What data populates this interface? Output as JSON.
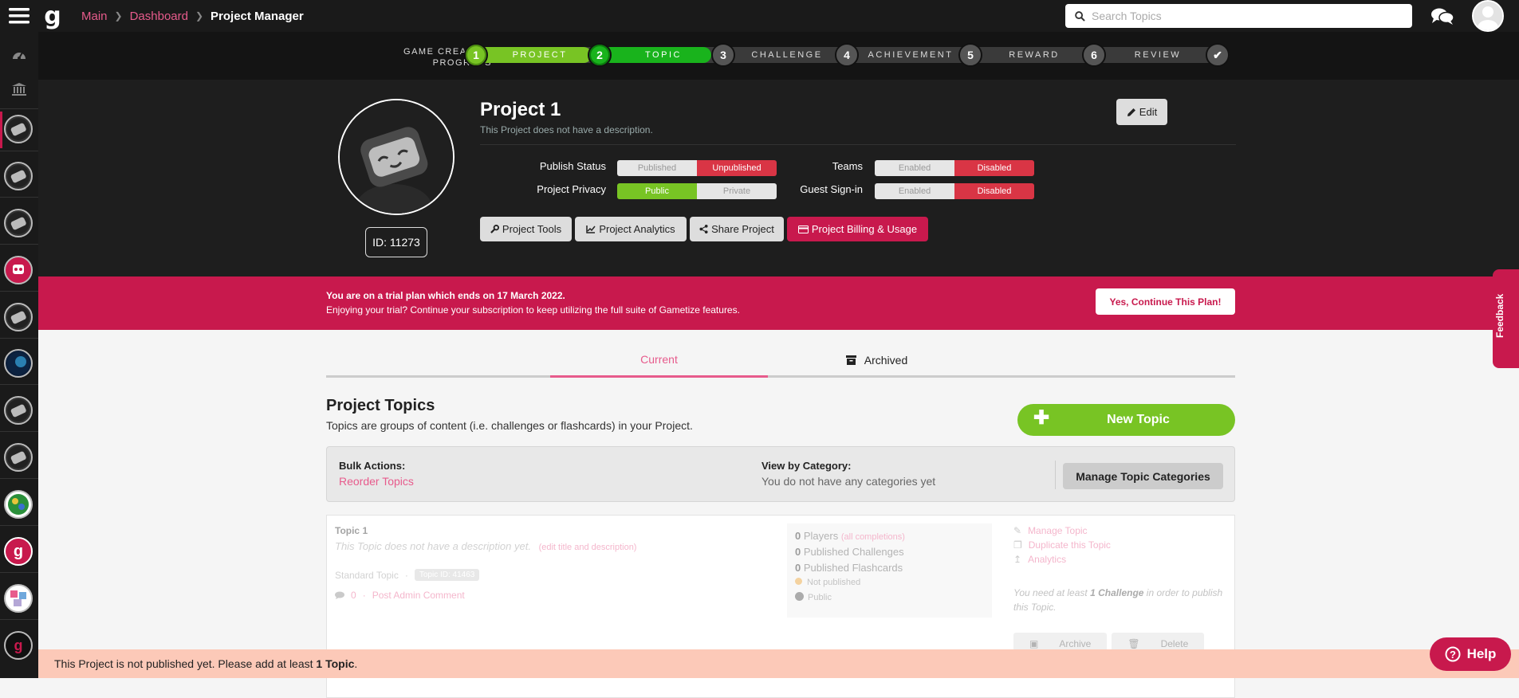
{
  "breadcrumb": {
    "main": "Main",
    "dashboard": "Dashboard",
    "current": "Project Manager"
  },
  "logo_letter": "g",
  "search": {
    "placeholder": "Search Topics"
  },
  "progress": {
    "label_line1": "GAME CREATION",
    "label_line2": "PROGRESS",
    "steps": [
      {
        "num": "1",
        "label": "PROJECT",
        "state": "done"
      },
      {
        "num": "2",
        "label": "TOPIC",
        "state": "current"
      },
      {
        "num": "3",
        "label": "CHALLENGE",
        "state": "todo"
      },
      {
        "num": "4",
        "label": "ACHIEVEMENT",
        "state": "todo"
      },
      {
        "num": "5",
        "label": "REWARD",
        "state": "todo"
      },
      {
        "num": "6",
        "label": "REVIEW",
        "state": "todo"
      }
    ],
    "final_mark": "✔"
  },
  "project": {
    "title": "Project 1",
    "description": "This Project does not have a description.",
    "id_label": "ID: 11273",
    "edit_label": "Edit",
    "publish_status": {
      "label": "Publish Status",
      "a": "Published",
      "b": "Unpublished"
    },
    "privacy": {
      "label": "Project Privacy",
      "a": "Public",
      "b": "Private"
    },
    "teams": {
      "label": "Teams",
      "a": "Enabled",
      "b": "Disabled"
    },
    "guest": {
      "label": "Guest Sign-in",
      "a": "Enabled",
      "b": "Disabled"
    },
    "tools": [
      "Project Tools",
      "Project Analytics",
      "Share Project",
      "Project Billing & Usage"
    ]
  },
  "trial": {
    "line1": "You are on a trial plan which ends on 17 March 2022.",
    "line2": "Enjoying your trial? Continue your subscription to keep utilizing the full suite of Gametize features.",
    "cta": "Yes, Continue This Plan!"
  },
  "feedback_label": "Feedback",
  "tabs": {
    "current": "Current",
    "archived": "Archived"
  },
  "topics": {
    "title": "Project Topics",
    "subtitle": "Topics are groups of content (i.e. challenges or flashcards) in your Project.",
    "new_topic": "New Topic",
    "bulk_label": "Bulk Actions:",
    "reorder": "Reorder Topics",
    "view_by_label": "View by Category:",
    "no_categories": "You do not have any categories yet",
    "manage_categories": "Manage Topic Categories"
  },
  "topic_card": {
    "name": "Topic 1",
    "desc": "This Topic does not have a description yet.",
    "edit_link": "(edit title and description)",
    "type": "Standard Topic",
    "dot": "·",
    "topic_id": "Topic ID: 41463",
    "comment_count": "0",
    "post_comment": "Post Admin Comment",
    "players_count": "0",
    "players_label": "Players",
    "all_completions": "(all completions)",
    "challenges_count": "0",
    "challenges_label": "Published Challenges",
    "flashcards_count": "0",
    "flashcards_label": "Published Flashcards",
    "status": "Not published",
    "privacy": "Public",
    "manage": "Manage Topic",
    "duplicate": "Duplicate this Topic",
    "analytics": "Analytics",
    "note_pre": "You need at least",
    "note_bold": "1 Challenge",
    "note_post": "in order to publish this Topic.",
    "archive": "Archive",
    "delete": "Delete"
  },
  "bottom": {
    "pre": "This Project is not published yet. Please add at least",
    "bold": "1 Topic",
    "post": "."
  },
  "help_label": "Help",
  "colors": {
    "brand_pink": "#c8194d",
    "link_pink": "#e75b8c",
    "green": "#78c424",
    "dark": "#1e1e1e"
  }
}
